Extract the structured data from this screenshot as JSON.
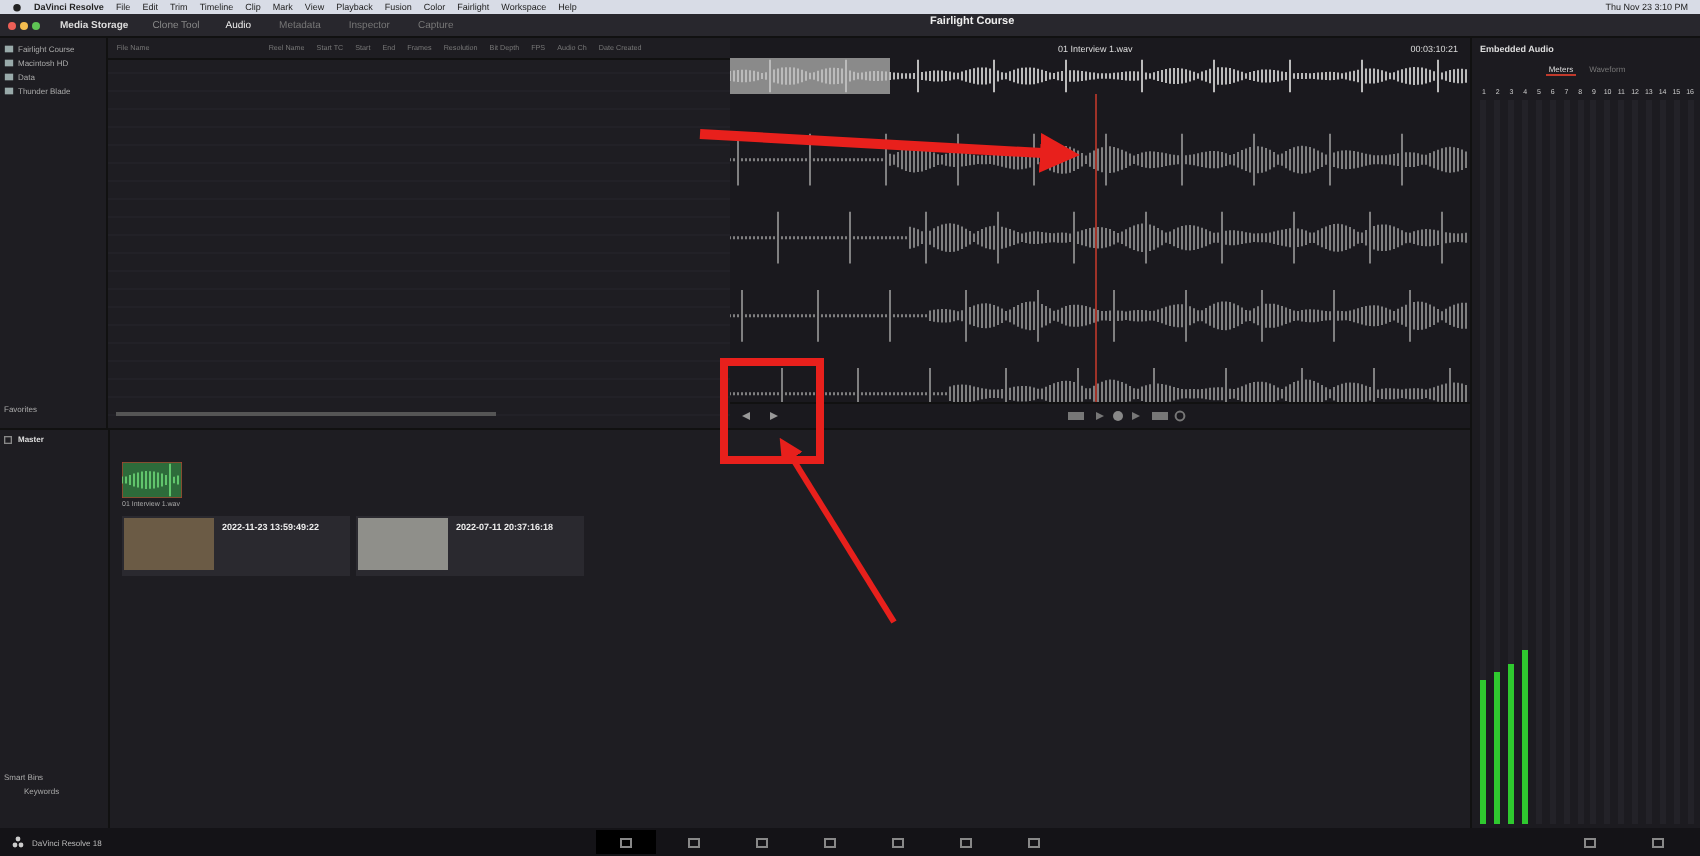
{
  "menu_bar": {
    "app": "DaVinci Resolve",
    "items": [
      "File",
      "Edit",
      "Trim",
      "Timeline",
      "Clip",
      "Mark",
      "View",
      "Playback",
      "Fusion",
      "Color",
      "Fairlight",
      "Workspace",
      "Help"
    ],
    "clock": "Thu Nov 23 3:10 PM"
  },
  "title_bar": {
    "media_storage": "Media Storage",
    "clone_tool": "Clone Tool",
    "project": "Fairlight Course",
    "pages": [
      {
        "label": "Audio",
        "selected": true
      },
      {
        "label": "Metadata",
        "selected": false
      },
      {
        "label": "Inspector",
        "selected": false
      },
      {
        "label": "Capture",
        "selected": false
      }
    ]
  },
  "storage_locations": [
    "Fairlight Course",
    "Macintosh HD",
    "Data",
    "Thunder Blade"
  ],
  "favorites_label": "Favorites",
  "file_table": {
    "columns": [
      "File Name",
      "Reel Name",
      "Start TC",
      "Start",
      "End",
      "Frames",
      "Resolution",
      "Bit Depth",
      "FPS",
      "Audio Ch",
      "Date Created"
    ]
  },
  "viewer": {
    "clip_name": "01 Interview 1.wav",
    "timecode": "00:03:10:21"
  },
  "media_pool": {
    "bins": [
      {
        "label": "Master",
        "selected": true
      }
    ],
    "smart_bins_label": "Smart Bins",
    "smart_bins": [
      "Keywords"
    ],
    "audio_clip": {
      "name": "01 Interview 1.wav"
    },
    "clips": [
      {
        "timestamp": "2022-11-23 13:59:49:22"
      },
      {
        "timestamp": "2022-07-11 20:37:16:18"
      }
    ]
  },
  "audio_panel": {
    "title": "Embedded Audio",
    "tabs": [
      {
        "label": "Meters",
        "selected": true
      },
      {
        "label": "Waveform",
        "selected": false
      }
    ],
    "channels": [
      {
        "label": "1",
        "level": 0.2
      },
      {
        "label": "2",
        "level": 0.21
      },
      {
        "label": "3",
        "level": 0.22
      },
      {
        "label": "4",
        "level": 0.24
      },
      {
        "label": "5"
      },
      {
        "label": "6"
      },
      {
        "label": "7"
      },
      {
        "label": "8"
      },
      {
        "label": "9"
      },
      {
        "label": "10"
      },
      {
        "label": "11"
      },
      {
        "label": "12"
      },
      {
        "label": "13"
      },
      {
        "label": "14"
      },
      {
        "label": "15"
      },
      {
        "label": "16"
      }
    ]
  },
  "taskbar": {
    "app": "DaVinci Resolve 18"
  }
}
